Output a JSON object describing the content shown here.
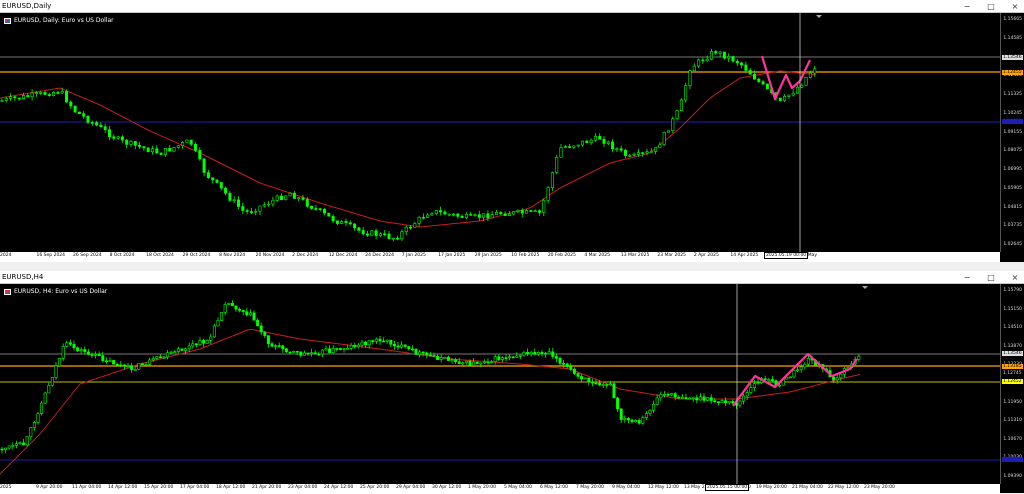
{
  "top": {
    "window_title": "EURUSD,Daily",
    "chart_label": "EURUSD, Daily:  Euro vs US Dollar",
    "price_ticks": [
      "1.15665",
      "1.14585",
      "1.13505",
      "1.12425",
      "1.11325",
      "1.10245",
      "1.09155",
      "1.08075",
      "1.06995",
      "1.05905",
      "1.04815",
      "1.03735",
      "1.02645"
    ],
    "current_price": "1.13546",
    "level_price": "1.12455",
    "blue_price": "1.08935",
    "time_labels": [
      "2024",
      "16 Sep 2024",
      "26 Sep 2024",
      "8 Oct 2024",
      "18 Oct 2024",
      "29 Oct 2024",
      "8 Nov 2024",
      "20 Nov 2024",
      "2 Dec 2024",
      "12 Dec 2024",
      "24 Dec 2024",
      "7 Jan 2025",
      "17 Jan 2025",
      "29 Jan 2025",
      "10 Feb 2025",
      "20 Feb 2025",
      "4 Mar 2025",
      "13 Mar 2025",
      "23 Mar 2025",
      "2 Apr 2025",
      "14 Apr 2025",
      "24 Apr 2025",
      "6 May"
    ],
    "cursor_time": "2025.05.19 00:00",
    "colors": {
      "candle": "#00ff00",
      "ma": "#c81e1e",
      "level": "#ffa500",
      "gray": "#a0a0a0",
      "blue": "#1e1eb4",
      "pattern": "#ff3399"
    }
  },
  "bottom": {
    "window_title": "EURUSD,H4",
    "chart_label": "EURUSD, H4:  Euro vs US Dollar",
    "price_ticks": [
      "1.15790",
      "1.15150",
      "1.14510",
      "1.13870",
      "1.13230",
      "1.12590",
      "1.11950",
      "1.11310",
      "1.10670",
      "1.10030",
      "1.09390"
    ],
    "current_price": "1.13546",
    "level_price_1": "1.13185",
    "level_price_2": "1.12452",
    "level_price_3": "1.12745",
    "blue_price": "1.09690",
    "time_labels": [
      "2025",
      "9 Apr 20:00",
      "11 Apr 04:00",
      "14 Apr 12:00",
      "15 Apr 20:00",
      "17 Apr 04:00",
      "18 Apr 12:00",
      "21 Apr 20:00",
      "23 Apr 04:00",
      "24 Apr 12:00",
      "25 Apr 20:00",
      "29 Apr 04:00",
      "30 Apr 12:00",
      "1 May 20:00",
      "5 May 04:00",
      "6 May 12:00",
      "7 May 20:00",
      "9 May 04:00",
      "12 May 12:00",
      "13 May 20:00",
      "15 May 04:00",
      "19 May 20:00",
      "21 May 04:00",
      "22 May 12:00",
      "23 May 20:00"
    ],
    "cursor_time": "2025.05.15 00:00",
    "colors": {
      "candle": "#00ff00",
      "ma": "#c81e1e",
      "level": "#ffa500",
      "yellow": "#ffff00",
      "gray": "#a0a0a0",
      "blue": "#1e1eb4",
      "pattern": "#ff3399"
    }
  },
  "window_buttons": {
    "minimize": "−",
    "maximize": "□",
    "close": "×"
  }
}
